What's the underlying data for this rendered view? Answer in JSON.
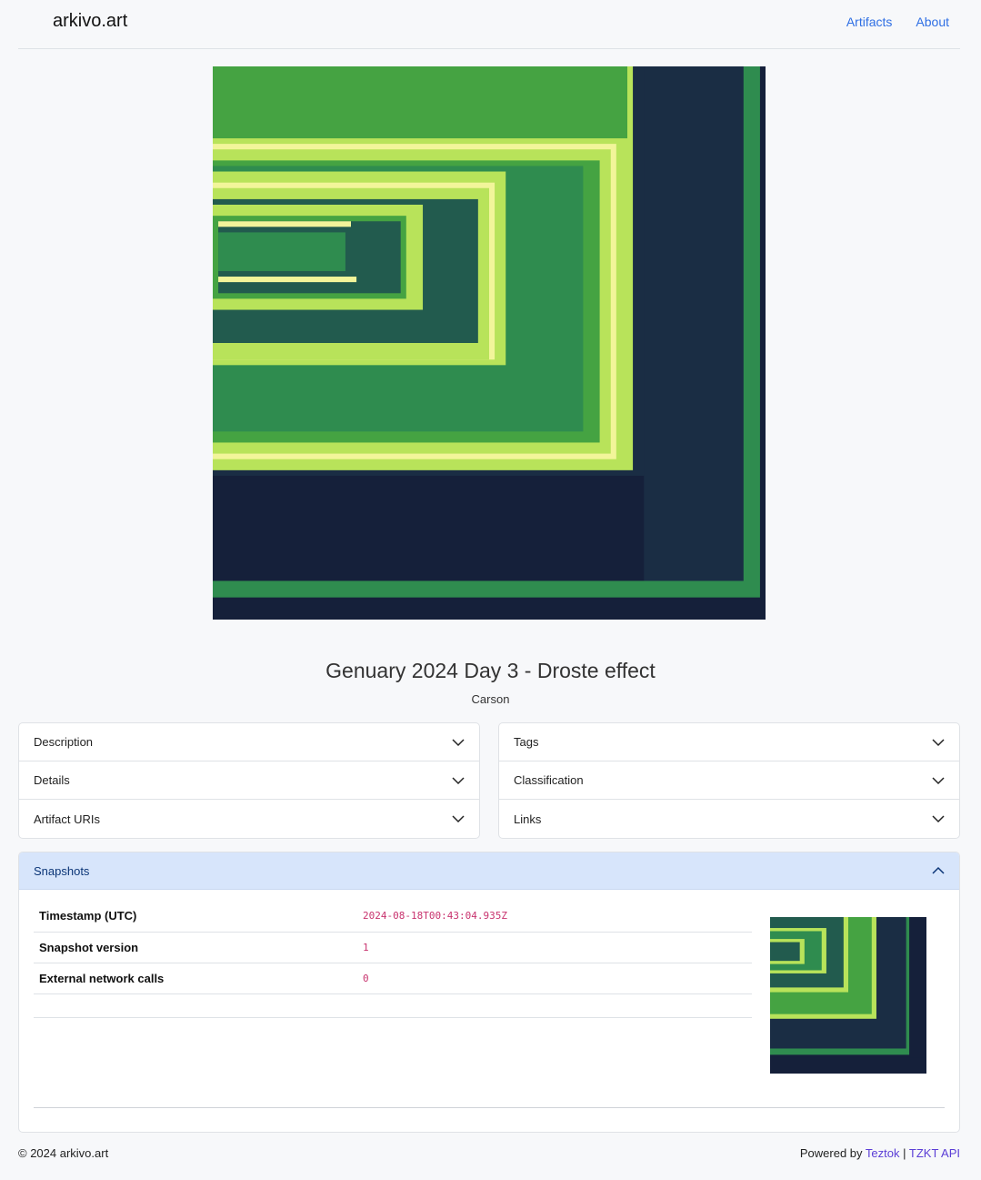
{
  "nav": {
    "brand": "arkivo.art",
    "links": [
      "Artifacts",
      "About"
    ]
  },
  "artwork": {
    "title": "Genuary 2024 Day 3 - Droste effect",
    "artist": "Carson",
    "palette": [
      "#15203a",
      "#2f8c4f",
      "#225b4e",
      "#45a342",
      "#5ad63a",
      "#b8e35a",
      "#f2f59a"
    ]
  },
  "panels": {
    "left": [
      "Description",
      "Details",
      "Artifact URIs"
    ],
    "right": [
      "Tags",
      "Classification",
      "Links"
    ]
  },
  "snapshots": {
    "header": "Snapshots",
    "rows": [
      {
        "label": "Timestamp (UTC)",
        "value": "2024-08-18T00:43:04.935Z"
      },
      {
        "label": "Snapshot version",
        "value": "1"
      },
      {
        "label": "External network calls",
        "value": "0"
      }
    ]
  },
  "footer": {
    "copyright": "© 2024 arkivo.art",
    "powered_by": "Powered by",
    "link1": "Teztok",
    "separator": "|",
    "link2": "TZKT API"
  },
  "icons": {
    "collapsed": "chevron-down-icon",
    "expanded": "chevron-up-icon"
  }
}
